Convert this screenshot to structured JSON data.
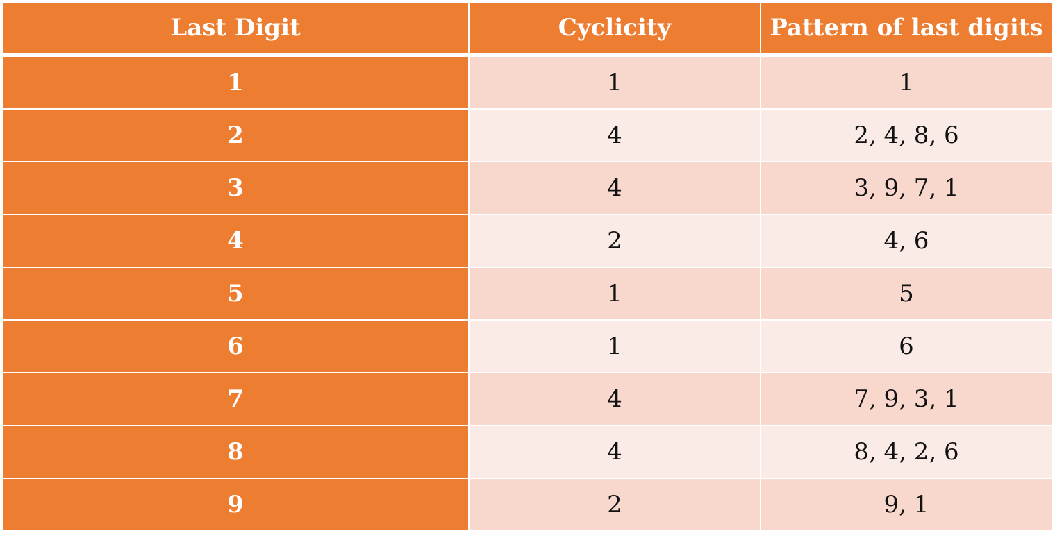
{
  "colors": {
    "header": "#ed7d31",
    "row_dark": "#f8d7cd",
    "row_light": "#fbebe7",
    "text_light": "#ffffff"
  },
  "headers": [
    "Last Digit",
    "Cyclicity",
    "Pattern of last digits"
  ],
  "rows": [
    {
      "digit": "1",
      "cyclicity": "1",
      "pattern": "1"
    },
    {
      "digit": "2",
      "cyclicity": "4",
      "pattern": "2, 4, 8, 6"
    },
    {
      "digit": "3",
      "cyclicity": "4",
      "pattern": "3, 9, 7, 1"
    },
    {
      "digit": "4",
      "cyclicity": "2",
      "pattern": "4, 6"
    },
    {
      "digit": "5",
      "cyclicity": "1",
      "pattern": "5"
    },
    {
      "digit": "6",
      "cyclicity": "1",
      "pattern": "6"
    },
    {
      "digit": "7",
      "cyclicity": "4",
      "pattern": "7, 9, 3, 1"
    },
    {
      "digit": "8",
      "cyclicity": "4",
      "pattern": "8, 4, 2, 6"
    },
    {
      "digit": "9",
      "cyclicity": "2",
      "pattern": "9, 1"
    }
  ]
}
